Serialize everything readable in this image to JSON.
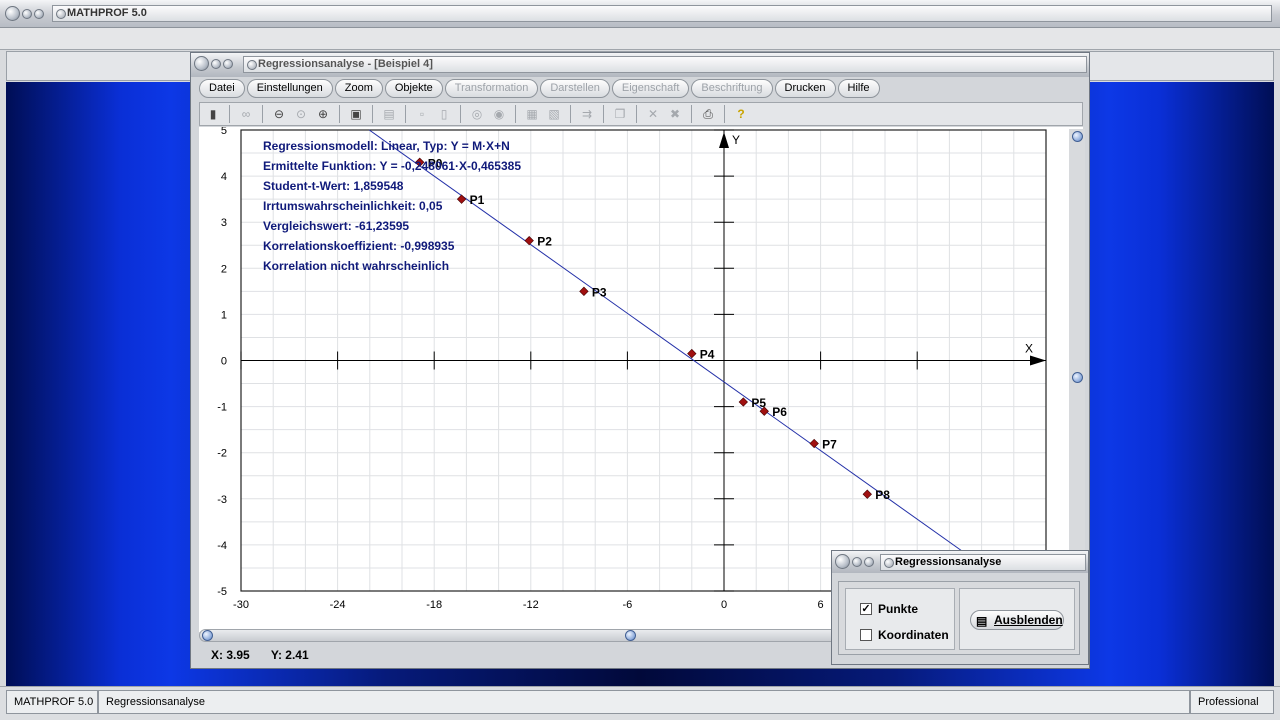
{
  "outer": {
    "title": "MATHPROF 5.0",
    "status": {
      "app": "MATHPROF 5.0",
      "module": "Regressionsanalyse",
      "edition": "Professional"
    }
  },
  "app": {
    "title": "Regressionsanalyse - [Beispiel 4]",
    "menu": [
      {
        "label": "Datei",
        "enabled": true
      },
      {
        "label": "Einstellungen",
        "enabled": true
      },
      {
        "label": "Zoom",
        "enabled": true
      },
      {
        "label": "Objekte",
        "enabled": true
      },
      {
        "label": "Transformation",
        "enabled": false
      },
      {
        "label": "Darstellen",
        "enabled": false
      },
      {
        "label": "Eigenschaft",
        "enabled": false
      },
      {
        "label": "Beschriftung",
        "enabled": false
      },
      {
        "label": "Drucken",
        "enabled": true
      },
      {
        "label": "Hilfe",
        "enabled": true
      }
    ],
    "coords": {
      "x": "X: 3.95",
      "y": "Y: 2.41"
    }
  },
  "info_lines": [
    "Regressionsmodell: Linear, Typ: Y = M·X+N",
    "Ermittelte Funktion: Y = -0,248061·X-0,465385",
    "Student-t-Wert: 1,859548",
    "Irrtumswahrscheinlichkeit: 0,05",
    "Vergleichswert: -61,23595",
    "Korrelationskoeffizient: -0,998935",
    "Korrelation nicht wahrscheinlich"
  ],
  "chart_data": {
    "type": "scatter",
    "xlabel": "X",
    "ylabel": "Y",
    "xlim": [
      -30,
      20
    ],
    "ylim": [
      -5,
      5
    ],
    "x_ticks": [
      "-30",
      "-24",
      "-18",
      "-12",
      "-6",
      "0",
      "6",
      "12"
    ],
    "y_ticks": [
      "5",
      "4",
      "3",
      "2",
      "1",
      "0",
      "-1",
      "-2",
      "-3",
      "-4",
      "-5"
    ],
    "grid": true,
    "points": [
      {
        "label": "P0",
        "x": -18.9,
        "y": 4.3
      },
      {
        "label": "P1",
        "x": -16.3,
        "y": 3.5
      },
      {
        "label": "P2",
        "x": -12.1,
        "y": 2.6
      },
      {
        "label": "P3",
        "x": -8.7,
        "y": 1.5
      },
      {
        "label": "P4",
        "x": -2.0,
        "y": 0.15
      },
      {
        "label": "P5",
        "x": 1.2,
        "y": -0.9
      },
      {
        "label": "P6",
        "x": 2.5,
        "y": -1.1
      },
      {
        "label": "P7",
        "x": 5.6,
        "y": -1.8
      },
      {
        "label": "P8",
        "x": 8.9,
        "y": -2.9
      }
    ],
    "regression": {
      "slope": -0.248061,
      "intercept": -0.465385
    }
  },
  "dialog": {
    "title": "Regressionsanalyse",
    "checkbox_points": {
      "label": "Punkte",
      "checked": true
    },
    "checkbox_coords": {
      "label": "Koordinaten",
      "checked": false
    },
    "hide_button": "Ausblenden"
  }
}
